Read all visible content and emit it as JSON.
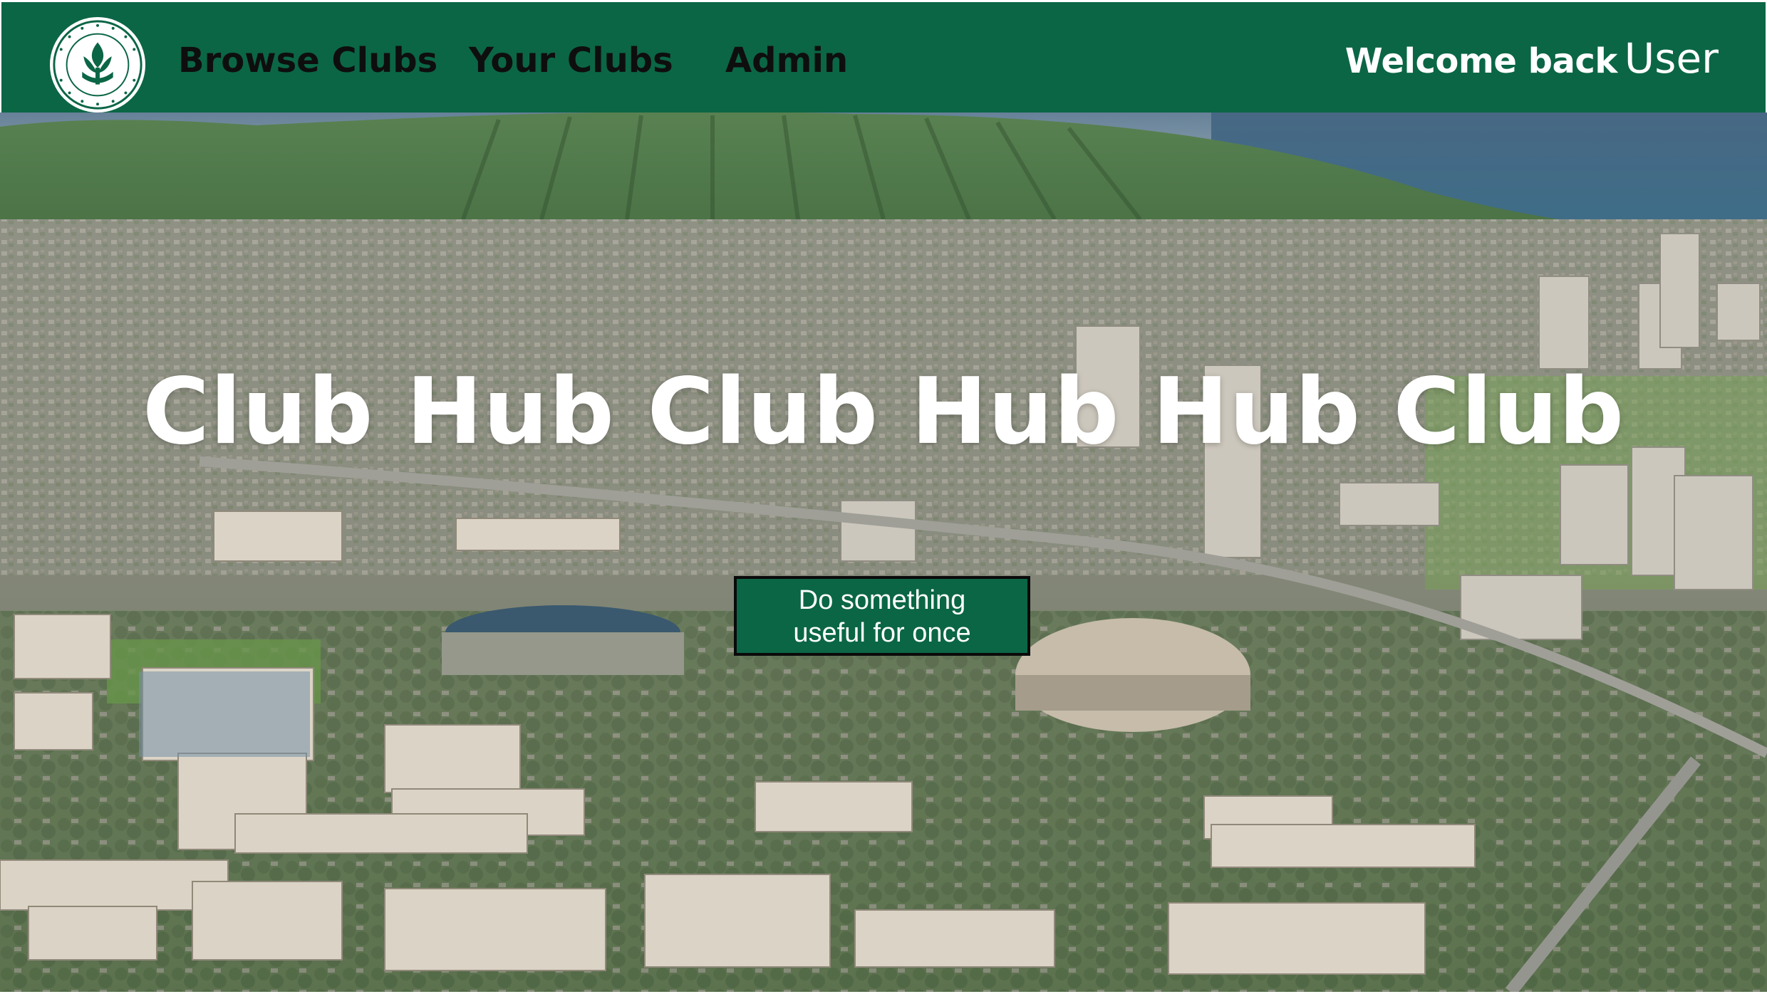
{
  "navbar": {
    "logo_alt_text": "UNIVERSITY OF HAWAI'I",
    "links": [
      {
        "label": "Browse Clubs"
      },
      {
        "label": "Your Clubs"
      },
      {
        "label": "Admin"
      }
    ],
    "welcome_prefix": "Welcome back",
    "welcome_user": "User",
    "background_color": "#0b6645"
  },
  "hero": {
    "background_image": "aerial view of Honolulu campus with Diamond Head mountain",
    "title": "Club Hub Club Hub Hub Club",
    "cta_label": "Do something\nuseful for once",
    "cta_color": "#0b6645"
  }
}
